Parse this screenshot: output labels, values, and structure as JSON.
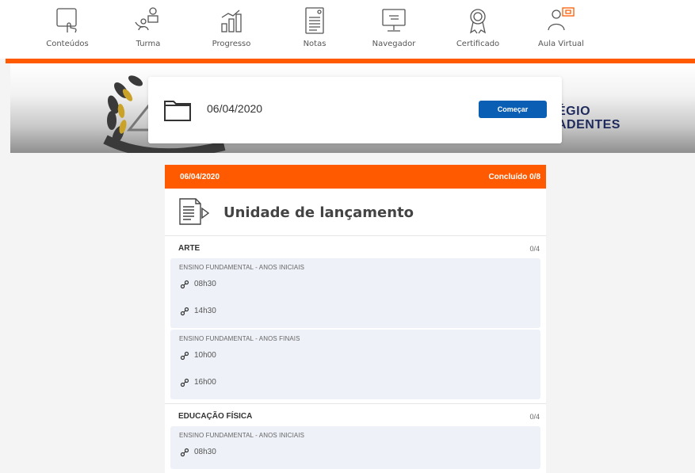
{
  "nav": {
    "items": [
      {
        "label": "Conteúdos",
        "icon": "tablet-touch-icon"
      },
      {
        "label": "Turma",
        "icon": "class-group-icon"
      },
      {
        "label": "Progresso",
        "icon": "progress-chart-icon"
      },
      {
        "label": "Notas",
        "icon": "notes-icon"
      },
      {
        "label": "Navegador",
        "icon": "browser-monitor-icon"
      },
      {
        "label": "Certificado",
        "icon": "certificate-icon"
      },
      {
        "label": "Aula Virtual",
        "icon": "virtual-class-icon"
      }
    ],
    "accent_color": "#ff5a00"
  },
  "banner": {
    "logo_text_line1": "ÉGIO",
    "logo_text_line2": "ADENTES"
  },
  "start_card": {
    "date": "06/04/2020",
    "button_label": "Começar",
    "button_color": "#0a5fb4"
  },
  "unit": {
    "date": "06/04/2020",
    "status": "Concluído 0/8",
    "title": "Unidade de lançamento",
    "subjects": [
      {
        "name": "ARTE",
        "count": "0/4",
        "levels": [
          {
            "title": "ENSINO FUNDAMENTAL - ANOS INICIAIS",
            "times": [
              "08h30",
              "14h30"
            ]
          },
          {
            "title": "ENSINO FUNDAMENTAL - ANOS FINAIS",
            "times": [
              "10h00",
              "16h00"
            ]
          }
        ]
      },
      {
        "name": "EDUCAÇÃO FÍSICA",
        "count": "0/4",
        "levels": [
          {
            "title": "ENSINO FUNDAMENTAL - ANOS INICIAIS",
            "times": [
              "08h30"
            ]
          }
        ]
      }
    ]
  }
}
